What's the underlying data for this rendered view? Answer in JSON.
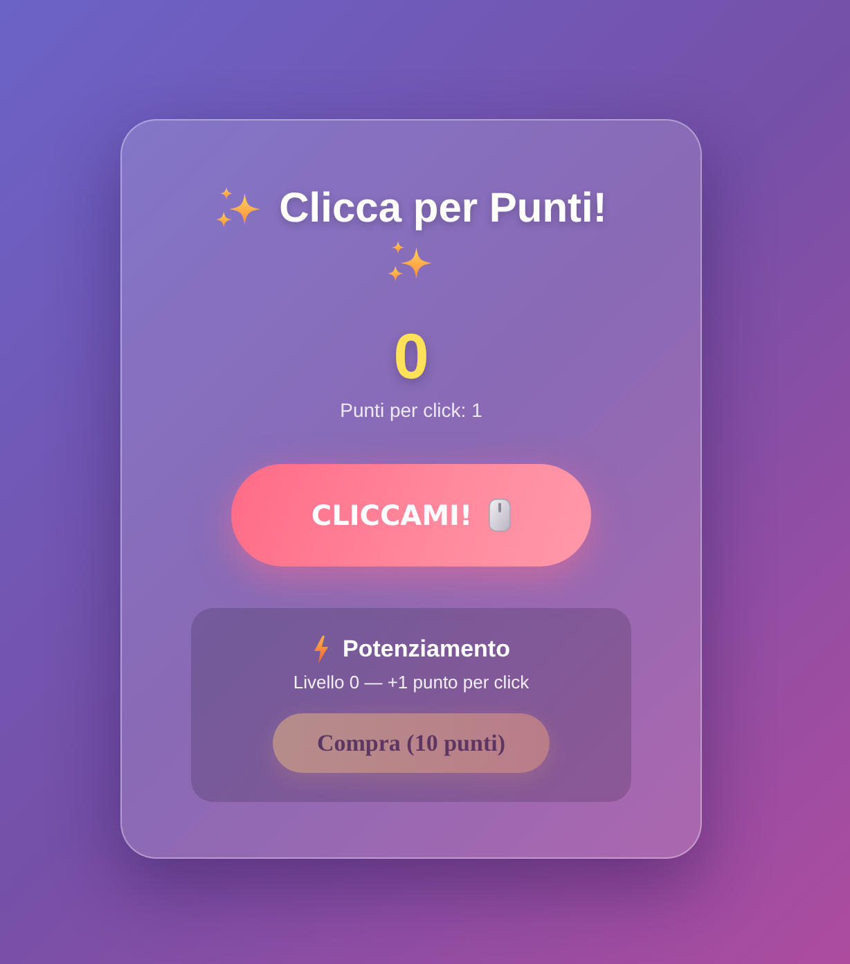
{
  "title": {
    "text": "Clicca per Punti!"
  },
  "score": {
    "value": "0",
    "caption": "Punti per click: 1"
  },
  "click_button": {
    "label": "CLICCAMI!"
  },
  "upgrade": {
    "title": "Potenziamento",
    "description": "Livello 0 — +1 punto per click",
    "buy_button": {
      "label": "Compra (10 punti)",
      "disabled": true
    }
  }
}
